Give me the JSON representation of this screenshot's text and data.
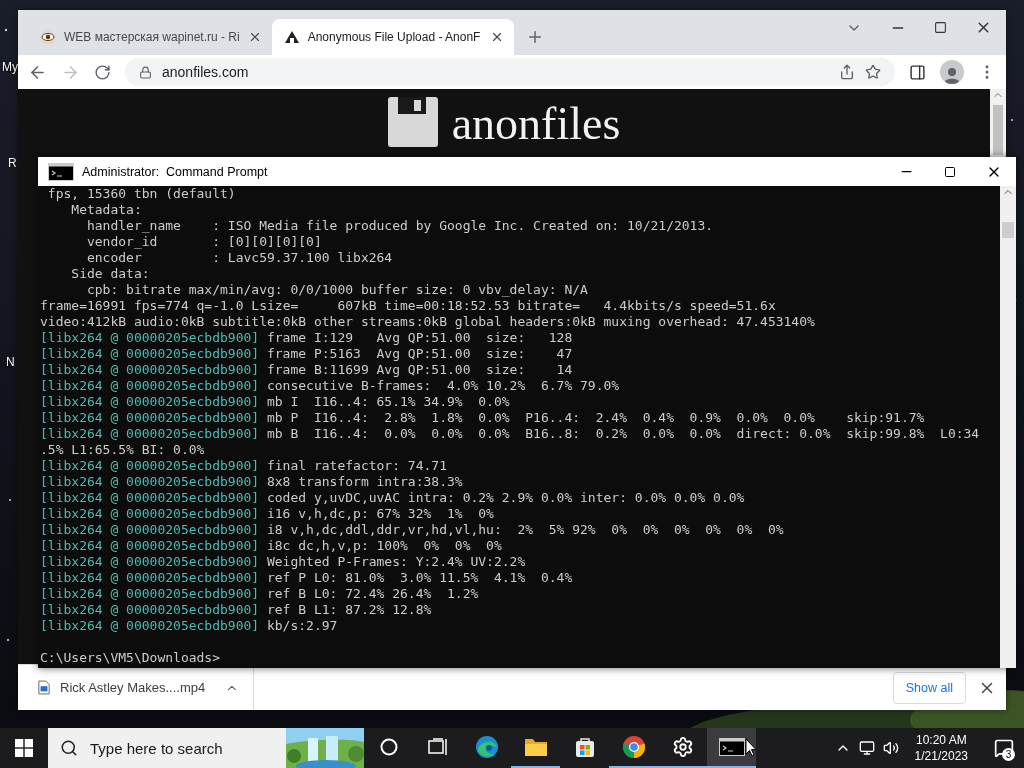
{
  "desktop": {
    "icon_labels": [
      "My",
      "R",
      "N"
    ]
  },
  "browser": {
    "tabs": [
      {
        "title": "WEB мастерская wapinet.ru - Ri",
        "kind": "eye",
        "selected": false
      },
      {
        "title": "Anonymous File Upload - AnonF",
        "kind": "anon",
        "selected": true
      }
    ],
    "address": "anonfiles.com",
    "forward_disabled": true,
    "page": {
      "logo_text": "anonfiles"
    },
    "download": {
      "file": "Rick Astley Makes....mp4"
    },
    "show_all": "Show all"
  },
  "console": {
    "title": "Administrator:  Command Prompt",
    "lines": [
      {
        "kind": "plain",
        "text": " fps, 15360 tbn (default)"
      },
      {
        "kind": "plain",
        "text": "    Metadata:"
      },
      {
        "kind": "plain",
        "text": "      handler_name    : ISO Media file produced by Google Inc. Created on: 10/21/2013."
      },
      {
        "kind": "plain",
        "text": "      vendor_id       : [0][0][0][0]"
      },
      {
        "kind": "plain",
        "text": "      encoder         : Lavc59.37.100 libx264"
      },
      {
        "kind": "plain",
        "text": "    Side data:"
      },
      {
        "kind": "plain",
        "text": "      cpb: bitrate max/min/avg: 0/0/1000 buffer size: 0 vbv_delay: N/A"
      },
      {
        "kind": "plain",
        "text": "frame=16991 fps=774 q=-1.0 Lsize=     607kB time=00:18:52.53 bitrate=   4.4kbits/s speed=51.6x"
      },
      {
        "kind": "plain",
        "text": "video:412kB audio:0kB subtitle:0kB other streams:0kB global headers:0kB muxing overhead: 47.453140%"
      },
      {
        "kind": "log",
        "prefix": "[libx264 @ 00000205ecbdb900]",
        "text": "frame I:129   Avg QP:51.00  size:   128"
      },
      {
        "kind": "log",
        "prefix": "[libx264 @ 00000205ecbdb900]",
        "text": "frame P:5163  Avg QP:51.00  size:    47"
      },
      {
        "kind": "log",
        "prefix": "[libx264 @ 00000205ecbdb900]",
        "text": "frame B:11699 Avg QP:51.00  size:    14"
      },
      {
        "kind": "log",
        "prefix": "[libx264 @ 00000205ecbdb900]",
        "text": "consecutive B-frames:  4.0% 10.2%  6.7% 79.0%"
      },
      {
        "kind": "log",
        "prefix": "[libx264 @ 00000205ecbdb900]",
        "text": "mb I  I16..4: 65.1% 34.9%  0.0%"
      },
      {
        "kind": "log",
        "prefix": "[libx264 @ 00000205ecbdb900]",
        "text": "mb P  I16..4:  2.8%  1.8%  0.0%  P16..4:  2.4%  0.4%  0.9%  0.0%  0.0%    skip:91.7%"
      },
      {
        "kind": "log",
        "prefix": "[libx264 @ 00000205ecbdb900]",
        "text": "mb B  I16..4:  0.0%  0.0%  0.0%  B16..8:  0.2%  0.0%  0.0%  direct: 0.0%  skip:99.8%  L0:34"
      },
      {
        "kind": "plain",
        "text": ".5% L1:65.5% BI: 0.0%"
      },
      {
        "kind": "log",
        "prefix": "[libx264 @ 00000205ecbdb900]",
        "text": "final ratefactor: 74.71"
      },
      {
        "kind": "log",
        "prefix": "[libx264 @ 00000205ecbdb900]",
        "text": "8x8 transform intra:38.3%"
      },
      {
        "kind": "log",
        "prefix": "[libx264 @ 00000205ecbdb900]",
        "text": "coded y,uvDC,uvAC intra: 0.2% 2.9% 0.0% inter: 0.0% 0.0% 0.0%"
      },
      {
        "kind": "log",
        "prefix": "[libx264 @ 00000205ecbdb900]",
        "text": "i16 v,h,dc,p: 67% 32%  1%  0%"
      },
      {
        "kind": "log",
        "prefix": "[libx264 @ 00000205ecbdb900]",
        "text": "i8 v,h,dc,ddl,ddr,vr,hd,vl,hu:  2%  5% 92%  0%  0%  0%  0%  0%  0%"
      },
      {
        "kind": "log",
        "prefix": "[libx264 @ 00000205ecbdb900]",
        "text": "i8c dc,h,v,p: 100%  0%  0%  0%"
      },
      {
        "kind": "log",
        "prefix": "[libx264 @ 00000205ecbdb900]",
        "text": "Weighted P-Frames: Y:2.4% UV:2.2%"
      },
      {
        "kind": "log",
        "prefix": "[libx264 @ 00000205ecbdb900]",
        "text": "ref P L0: 81.0%  3.0% 11.5%  4.1%  0.4%"
      },
      {
        "kind": "log",
        "prefix": "[libx264 @ 00000205ecbdb900]",
        "text": "ref B L0: 72.4% 26.4%  1.2%"
      },
      {
        "kind": "log",
        "prefix": "[libx264 @ 00000205ecbdb900]",
        "text": "ref B L1: 87.2% 12.8%"
      },
      {
        "kind": "log",
        "prefix": "[libx264 @ 00000205ecbdb900]",
        "text": "kb/s:2.97"
      }
    ],
    "prompt": "C:\\Users\\VM5\\Downloads>"
  },
  "taskbar": {
    "search_placeholder": "Type here to search",
    "apps": [
      {
        "kind": "cortana",
        "running": false,
        "selected": false
      },
      {
        "kind": "taskview",
        "running": false,
        "selected": false
      },
      {
        "kind": "edge",
        "running": false,
        "selected": false
      },
      {
        "kind": "explorer",
        "running": true,
        "selected": false
      },
      {
        "kind": "store",
        "running": false,
        "selected": false
      },
      {
        "kind": "chrome",
        "running": true,
        "selected": false
      },
      {
        "kind": "settings",
        "running": true,
        "selected": false
      },
      {
        "kind": "console",
        "running": true,
        "selected": true
      }
    ],
    "clock": {
      "time": "10:20 AM",
      "date": "1/21/2023"
    },
    "notification_count": "3"
  }
}
